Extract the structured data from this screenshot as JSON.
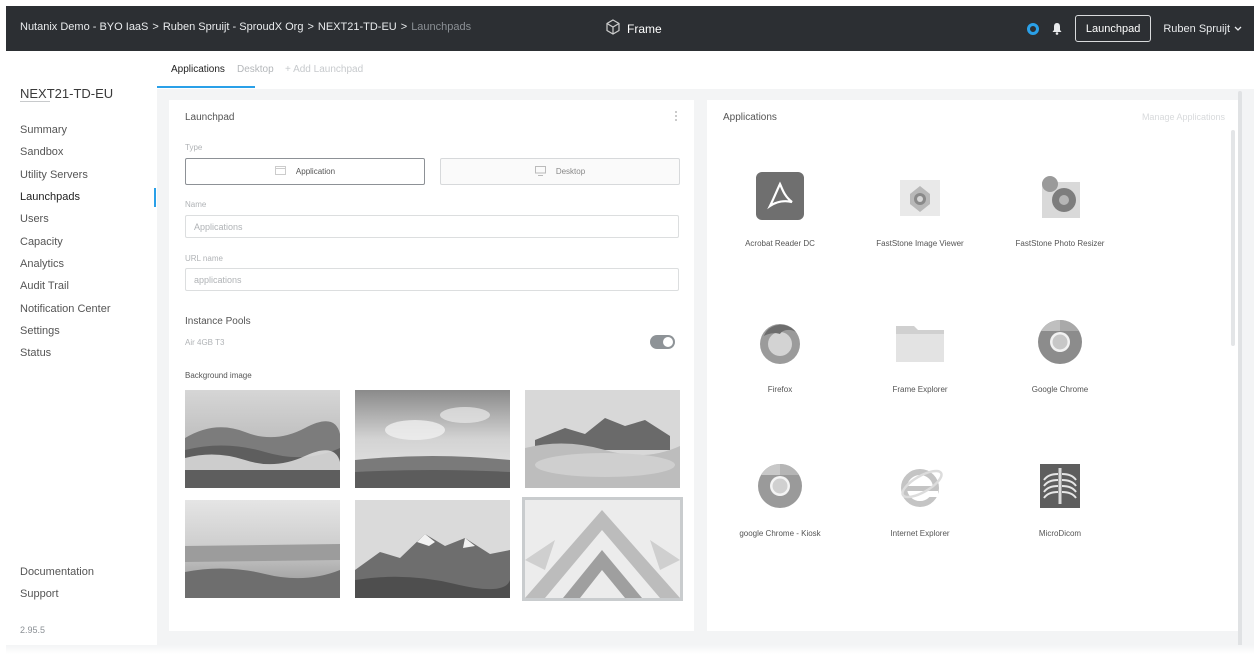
{
  "topbar": {
    "breadcrumbs": [
      "Nutanix Demo - BYO IaaS",
      "Ruben Spruijt - SproudX Org",
      "NEXT21-TD-EU",
      "Launchpads"
    ],
    "separator": ">",
    "brand": "Frame",
    "launchpad_button": "Launchpad",
    "user": "Ruben Spruijt",
    "accent_color": "#2aa0e8"
  },
  "sidebar": {
    "title": "NEXT21-TD-EU",
    "items": [
      {
        "label": "Summary"
      },
      {
        "label": "Sandbox"
      },
      {
        "label": "Utility Servers"
      },
      {
        "label": "Launchpads"
      },
      {
        "label": "Users"
      },
      {
        "label": "Capacity"
      },
      {
        "label": "Analytics"
      },
      {
        "label": "Audit Trail"
      },
      {
        "label": "Notification Center"
      },
      {
        "label": "Settings"
      },
      {
        "label": "Status"
      }
    ],
    "active_item": "Launchpads",
    "bottom": [
      "Documentation",
      "Support"
    ],
    "version": "2.95.5"
  },
  "tabs": {
    "applications": "Applications",
    "desktop": "Desktop",
    "add": "+ Add Launchpad"
  },
  "launchpad": {
    "title": "Launchpad",
    "type_label": "Type",
    "type_application": "Application",
    "type_desktop": "Desktop",
    "selected_type": "Application",
    "name_label": "Name",
    "name_value": "Applications",
    "url_label": "URL name",
    "url_value": "applications",
    "instance_pools_title": "Instance Pools",
    "instance_pool": "Air 4GB T3",
    "instance_pool_enabled": true,
    "background_label": "Background image",
    "selected_background": 6
  },
  "applications": {
    "title": "Applications",
    "manage": "Manage Applications",
    "apps": [
      {
        "name": "Acrobat Reader DC",
        "icon": "acrobat-icon"
      },
      {
        "name": "FastStone Image Viewer",
        "icon": "faststone-viewer-icon"
      },
      {
        "name": "FastStone Photo Resizer",
        "icon": "faststone-resizer-icon"
      },
      {
        "name": "Firefox",
        "icon": "firefox-icon"
      },
      {
        "name": "Frame Explorer",
        "icon": "folder-icon"
      },
      {
        "name": "Google Chrome",
        "icon": "chrome-icon"
      },
      {
        "name": "google Chrome - Kiosk",
        "icon": "chrome-icon"
      },
      {
        "name": "Internet Explorer",
        "icon": "ie-icon"
      },
      {
        "name": "MicroDicom",
        "icon": "xray-icon"
      }
    ]
  }
}
